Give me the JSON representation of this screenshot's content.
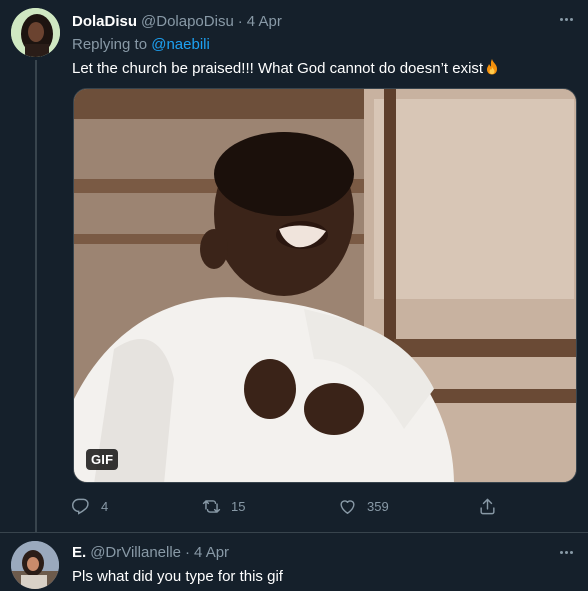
{
  "tweets": [
    {
      "author_name": "DolaDisu",
      "author_handle": "@DolapoDisu",
      "separator": "·",
      "time": "4 Apr",
      "replying_prefix": "Replying to",
      "replying_to": "@naebili",
      "text": "Let the church be praised!!! What God cannot do doesn’t exist",
      "emoji_icon": "fire-icon",
      "media_badge": "GIF",
      "stats": {
        "replies": "4",
        "retweets": "15",
        "likes": "359"
      }
    },
    {
      "author_name": "E.",
      "author_handle": "@DrVillanelle",
      "separator": "·",
      "time": "4 Apr",
      "text": "Pls what did you type for this gif"
    }
  ],
  "icons": {
    "more": "more-horizontal-icon",
    "reply": "reply-icon",
    "retweet": "retweet-icon",
    "like": "heart-icon",
    "share": "share-icon"
  },
  "colors": {
    "background": "#15202b",
    "secondary_text": "#8899a6",
    "link": "#1da1f2",
    "divider": "#38444d"
  }
}
